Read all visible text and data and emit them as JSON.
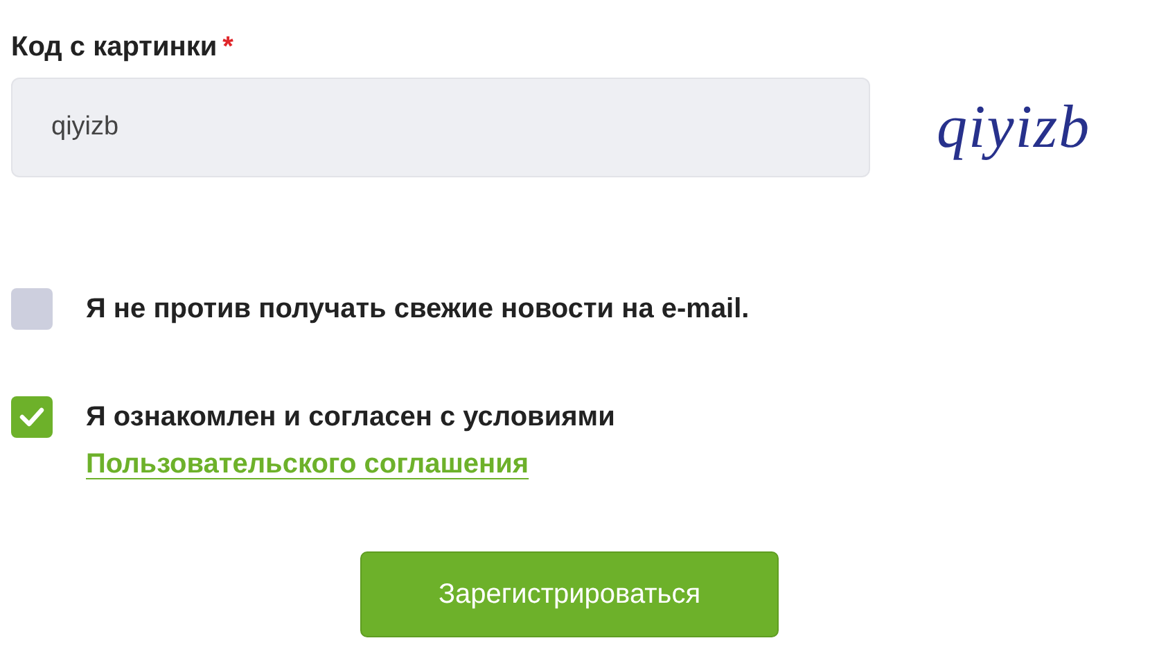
{
  "captcha_field": {
    "label": "Код с картинки",
    "required_mark": "*",
    "value": "qiyizb"
  },
  "captcha_image": {
    "text": "qiyizb"
  },
  "checkboxes": [
    {
      "text": "Я не против получать свежие новости на e-mail.",
      "checked": false
    },
    {
      "text": "Я ознакомлен и согласен с условиями",
      "link": "Пользовательского соглашения",
      "checked": true
    }
  ],
  "submit_button": "Зарегистрироваться"
}
